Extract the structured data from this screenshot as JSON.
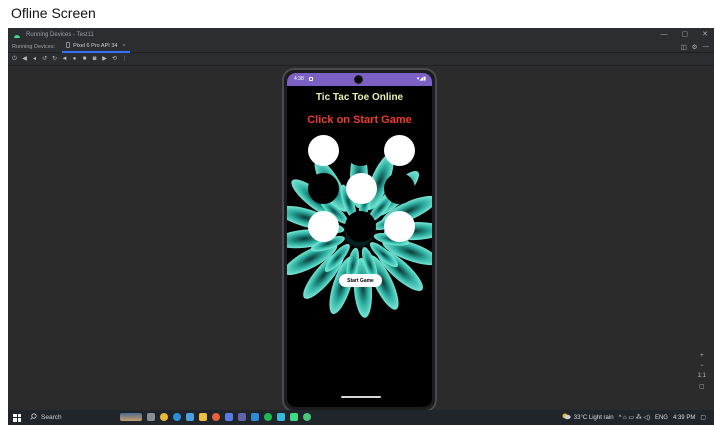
{
  "caption": "Ofline Screen",
  "window": {
    "title": "Running Devices - Test11",
    "controls": [
      "—",
      "▢",
      "✕"
    ]
  },
  "device_bar": {
    "label": "Running Devices:",
    "tab_label": "Pixel 6 Pro API 34",
    "tab_close": "×"
  },
  "toolbar": {
    "icons": [
      "power-icon",
      "volume-up-icon",
      "volume-down-icon",
      "rotate-left-icon",
      "rotate-right-icon",
      "back-icon",
      "home-icon",
      "overview-icon",
      "screenshot-icon",
      "record-icon",
      "reset-icon",
      "more-icon"
    ]
  },
  "phone": {
    "status_time": "4:38",
    "status_right": "▾◢▮",
    "app_title": "Tic Tac Toe Online",
    "status_message": "Click on Start Game",
    "start_button": "Start Game",
    "board": [
      "filled",
      "empty",
      "filled",
      "empty",
      "filled",
      "empty",
      "filled",
      "empty",
      "filled"
    ]
  },
  "zoom": {
    "in": "+",
    "out": "−",
    "ratio": "1:1"
  },
  "taskbar": {
    "search": "Search",
    "weather": "33°C  Light rain",
    "tray_icons": "^ ⌂ ▭ ⁂ ◁)",
    "language": "ENG",
    "time": "4:39 PM"
  },
  "colors": {
    "status_bar": "#7b61c4",
    "title_text": "#e8f0a8",
    "status_text": "#f03a2a",
    "ide_bg": "#2b2d30",
    "canvas_bg": "#2b2b2b"
  }
}
